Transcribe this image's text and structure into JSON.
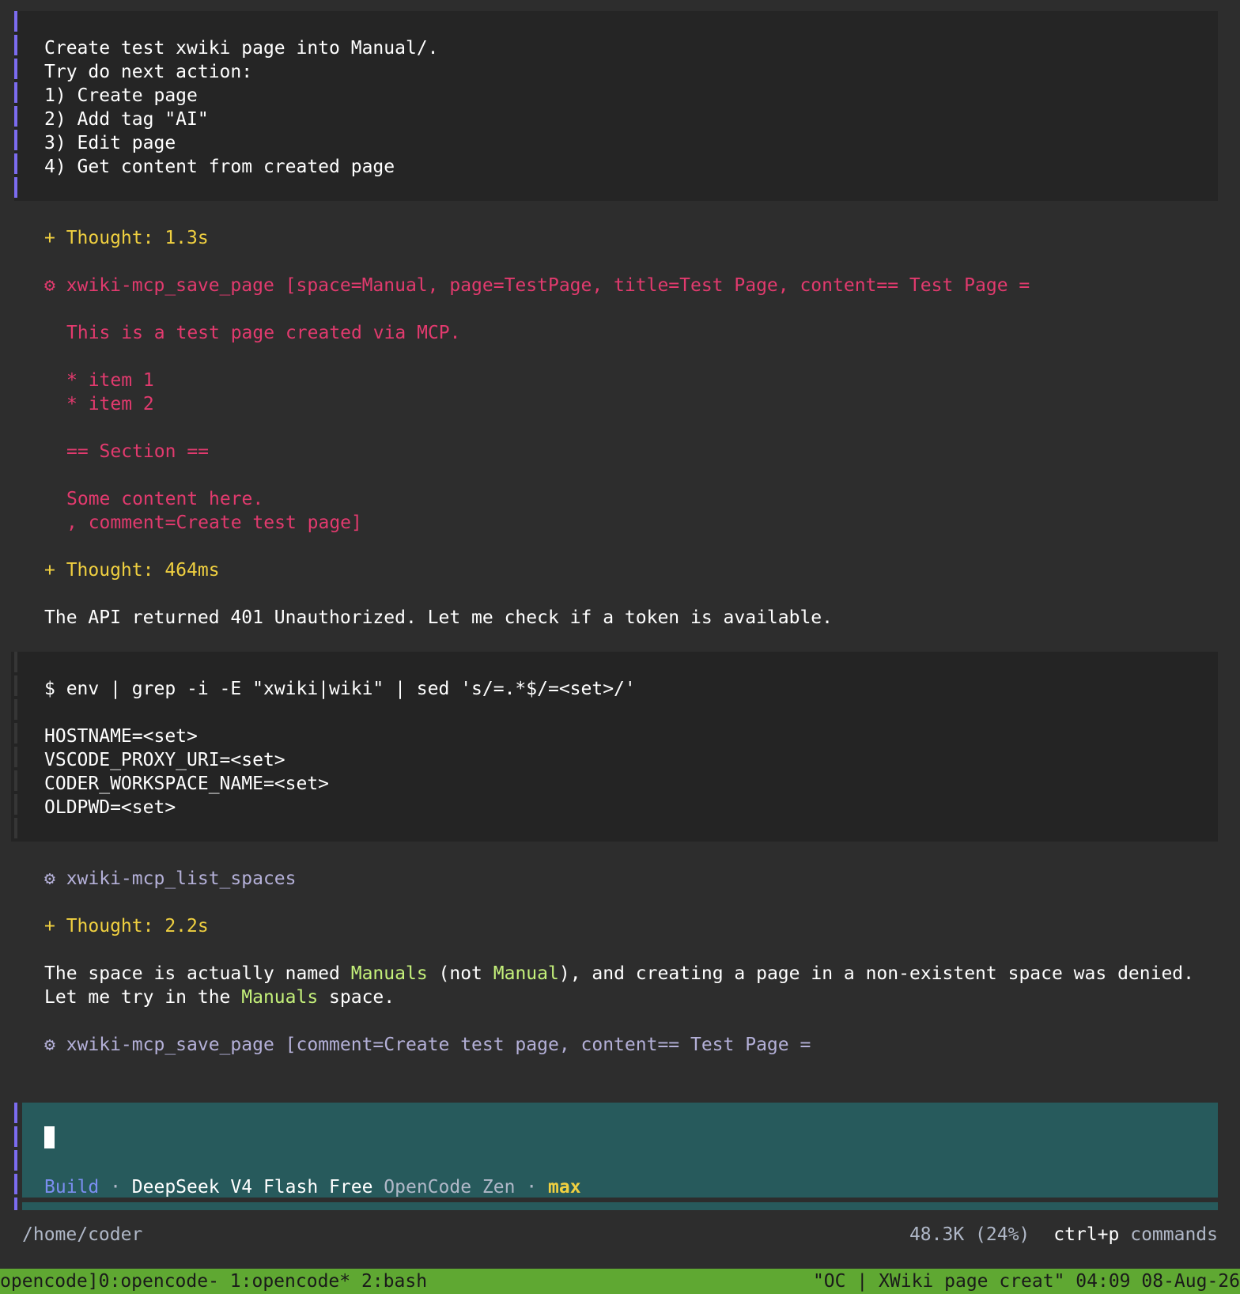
{
  "user_message": {
    "lines": [
      "Create test xwiki page into Manual/.",
      "Try do next action:",
      "1) Create page",
      "2) Add tag \"AI\"",
      "3) Edit page",
      "4) Get content from created page"
    ]
  },
  "transcript": {
    "thought1": "+ Thought: 1.3s",
    "tool1": {
      "icon": "gear-icon",
      "head": "⚙ xwiki-mcp_save_page [space=Manual, page=TestPage, title=Test Page, content== Test Page =",
      "body": [
        "This is a test page created via MCP.",
        "* item 1",
        "* item 2",
        "== Section ==",
        "Some content here.",
        ", comment=Create test page]"
      ]
    },
    "thought2": "+ Thought: 464ms",
    "text1": "The API returned 401 Unauthorized. Let me check if a token is available.",
    "bash": {
      "command": "$ env | grep -i -E \"xwiki|wiki\" | sed 's/=.*$/=<set>/'",
      "output": [
        "HOSTNAME=<set>",
        "VSCODE_PROXY_URI=<set>",
        "CODER_WORKSPACE_NAME=<set>",
        "OLDPWD=<set>"
      ]
    },
    "tool2": "⚙ xwiki-mcp_list_spaces",
    "thought3": "+ Thought: 2.2s",
    "text2": {
      "p1": "The space is actually named ",
      "h1": "Manuals",
      "p2": " (not ",
      "h2": "Manual",
      "p3": "), and creating a page in a non-existent space was denied.",
      "p4": "Let me try in the ",
      "h3": "Manuals",
      "p5": " space."
    },
    "tool3": "⚙ xwiki-mcp_save_page [comment=Create test page, content== Test Page ="
  },
  "input": {
    "mode": "Build",
    "sep1": " · ",
    "model": "DeepSeek V4 Flash Free",
    "provider": " OpenCode Zen",
    "sep2": " · ",
    "variant": "max"
  },
  "footer": {
    "path": "/home/coder",
    "tokens": "48.3K (24%)",
    "shortcut": "ctrl+p",
    "shortcut_label": " commands"
  },
  "tmux": {
    "left": "opencode]0:opencode- 1:opencode* 2:bash",
    "right": "\"OC | XWiki page creat\" 04:09 08-Aug-26"
  },
  "colors": {
    "background": "#2d2d2d",
    "accent_purple": "#7c6cf0",
    "thought_yellow": "#f0d040",
    "error_pink": "#e23a6e",
    "highlight_green": "#c4f07a",
    "input_teal": "#275a5c",
    "tmux_green": "#5fa832"
  }
}
